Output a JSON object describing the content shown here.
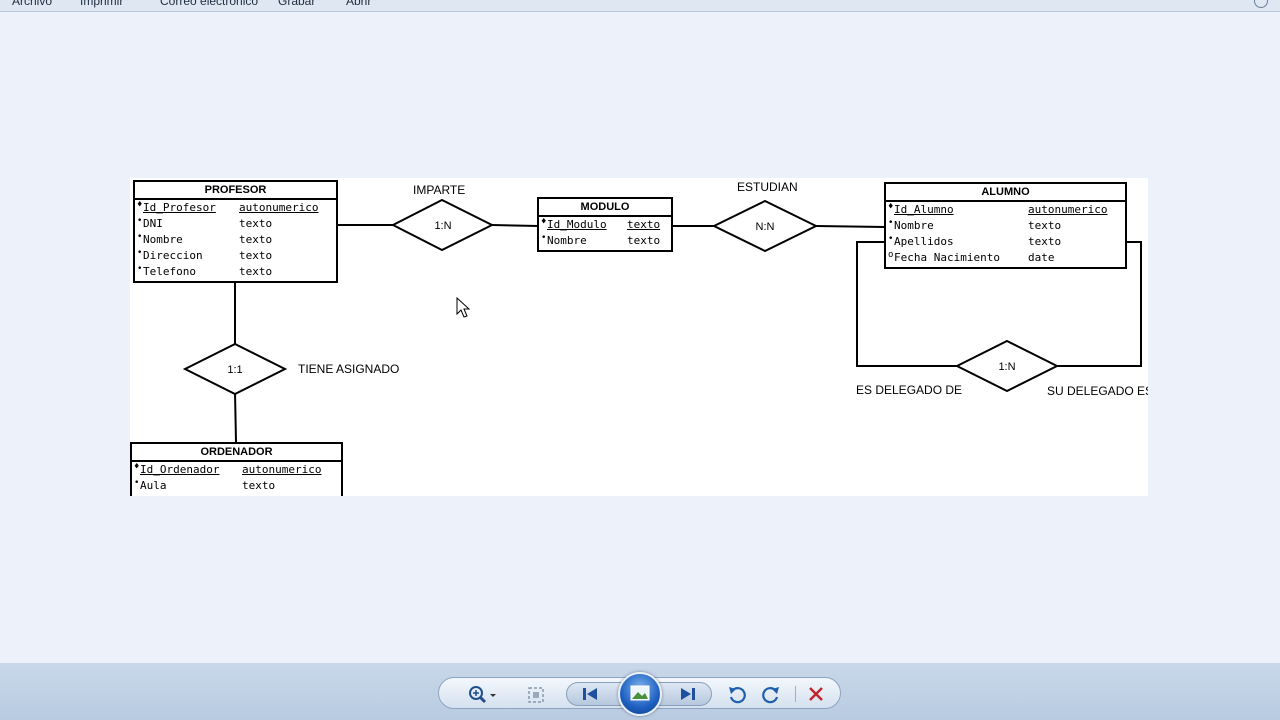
{
  "menu": {
    "items": [
      "Archivo",
      "Imprimir",
      "Correo electrónico",
      "Grabar",
      "Abrir"
    ]
  },
  "diagram": {
    "entities": {
      "profesor": {
        "title": "PROFESOR",
        "attributes": [
          {
            "marker": "♦",
            "name": "Id_Profesor",
            "type": "autonumerico",
            "key": true
          },
          {
            "marker": "•",
            "name": "DNI",
            "type": "texto"
          },
          {
            "marker": "•",
            "name": "Nombre",
            "type": "texto"
          },
          {
            "marker": "•",
            "name": "Direccion",
            "type": "texto"
          },
          {
            "marker": "•",
            "name": "Telefono",
            "type": "texto"
          }
        ]
      },
      "modulo": {
        "title": "MODULO",
        "attributes": [
          {
            "marker": "♦",
            "name": "Id_Modulo",
            "type": "texto",
            "key": true
          },
          {
            "marker": "•",
            "name": "Nombre",
            "type": "texto"
          }
        ]
      },
      "alumno": {
        "title": "ALUMNO",
        "attributes": [
          {
            "marker": "♦",
            "name": "Id_Alumno",
            "type": "autonumerico",
            "key": true
          },
          {
            "marker": "•",
            "name": "Nombre",
            "type": "texto"
          },
          {
            "marker": "•",
            "name": "Apellidos",
            "type": "texto"
          },
          {
            "marker": "o",
            "name": "Fecha Nacimiento",
            "type": "date"
          }
        ]
      },
      "ordenador": {
        "title": "ORDENADOR",
        "attributes": [
          {
            "marker": "♦",
            "name": "Id_Ordenador",
            "type": "autonumerico",
            "key": true
          },
          {
            "marker": "•",
            "name": "Aula",
            "type": "texto"
          }
        ]
      }
    },
    "relationships": {
      "imparte": {
        "label": "IMPARTE",
        "cardinality": "1:N"
      },
      "estudian": {
        "label": "ESTUDIAN",
        "cardinality": "N:N"
      },
      "tiene_asignado": {
        "label": "TIENE ASIGNADO",
        "cardinality": "1:1"
      },
      "delegado": {
        "cardinality": "1:N",
        "role_left": "ES DELEGADO DE",
        "role_right": "SU DELEGADO ES"
      }
    }
  },
  "toolbar": {
    "icons": [
      "zoom-icon",
      "fit-window-icon",
      "previous-icon",
      "slideshow-icon",
      "next-icon",
      "rotate-left-icon",
      "rotate-right-icon",
      "delete-icon"
    ],
    "colors": {
      "bar": "#c3d3e7",
      "accent": "#1d5fbf",
      "delete": "#c0272d"
    }
  }
}
